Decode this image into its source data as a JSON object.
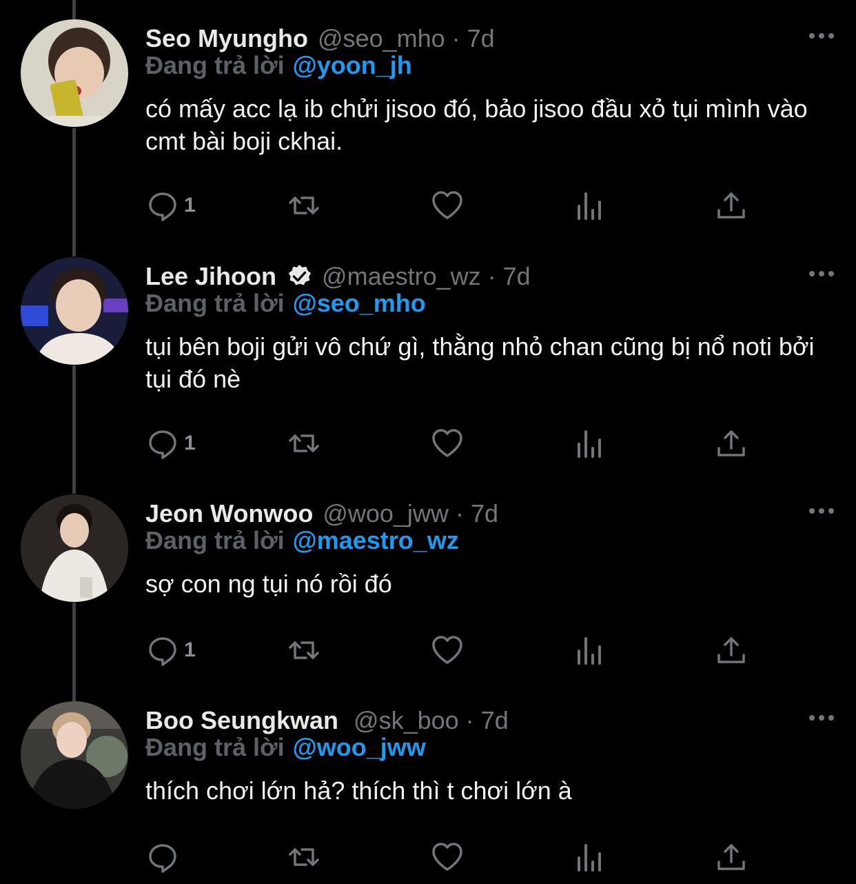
{
  "reply_prefix": "Đang trả lời",
  "colors": {
    "accent": "#1d9bf0",
    "muted": "#71767b",
    "background": "#000000"
  },
  "tweets": [
    {
      "name": "Seo Myungho",
      "handle": "@seo_mho",
      "dot": "·",
      "time": "7d",
      "verified": false,
      "reply_to": "@yoon_jh",
      "text": "có mấy acc lạ ib chửi jisoo đó, bảo jisoo đầu xỏ tụi mình vào cmt bài boji ckhai.",
      "reply_count": "1",
      "avatar_icon": "person-photo"
    },
    {
      "name": "Lee Jihoon",
      "handle": "@maestro_wz",
      "dot": "·",
      "time": "7d",
      "verified": true,
      "reply_to": "@seo_mho",
      "text": "tụi bên boji gửi vô chứ gì, thằng nhỏ chan cũng bị nổ noti bởi tụi đó nè",
      "reply_count": "1",
      "avatar_icon": "person-photo"
    },
    {
      "name": "Jeon Wonwoo",
      "handle": "@woo_jww",
      "dot": "·",
      "time": "7d",
      "verified": false,
      "reply_to": "@maestro_wz",
      "text": "sợ con ng tụi nó rồi đó",
      "reply_count": "1",
      "avatar_icon": "person-photo"
    },
    {
      "name": "Boo Seungkwan",
      "handle": "@sk_boo",
      "dot": "·",
      "time": "7d",
      "verified": false,
      "reply_to": "@woo_jww",
      "text": "thích chơi lớn hả? thích thì t chơi lớn à",
      "reply_count": "",
      "avatar_icon": "person-photo"
    }
  ]
}
